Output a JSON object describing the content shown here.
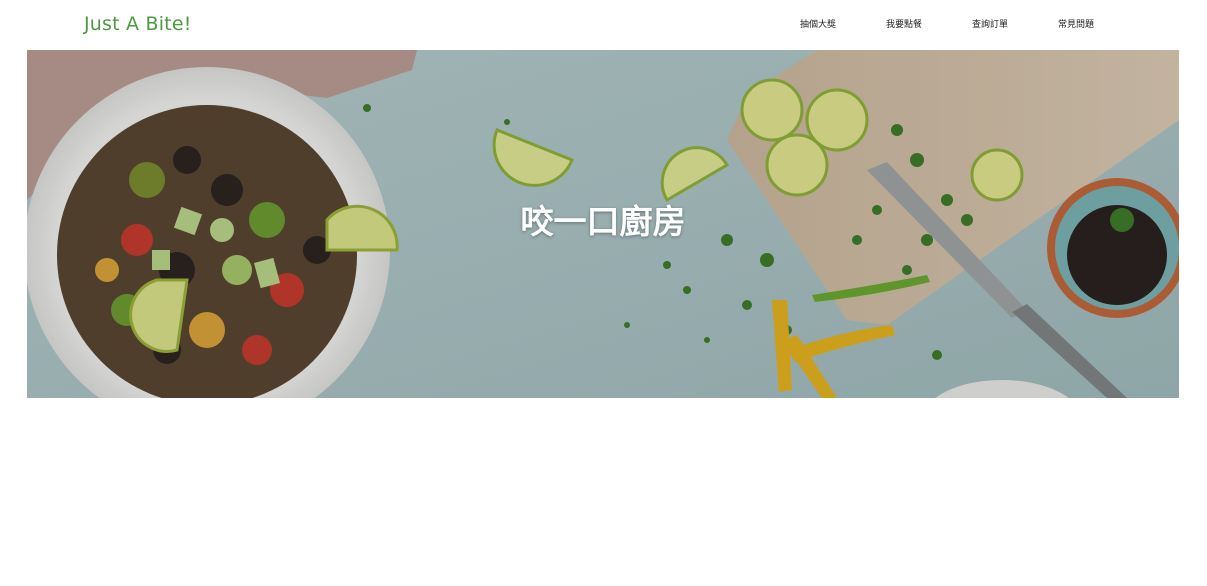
{
  "header": {
    "brand": "Just A Bite!",
    "nav": [
      {
        "label": "抽個大獎"
      },
      {
        "label": "我要點餐"
      },
      {
        "label": "查詢訂單"
      },
      {
        "label": "常見問題"
      }
    ]
  },
  "hero": {
    "title": "咬一口廚房"
  },
  "colors": {
    "brand": "#4a9a3e",
    "nav_text": "#222222",
    "hero_bg": "#a9c2c4",
    "hero_title": "#ffffff"
  }
}
